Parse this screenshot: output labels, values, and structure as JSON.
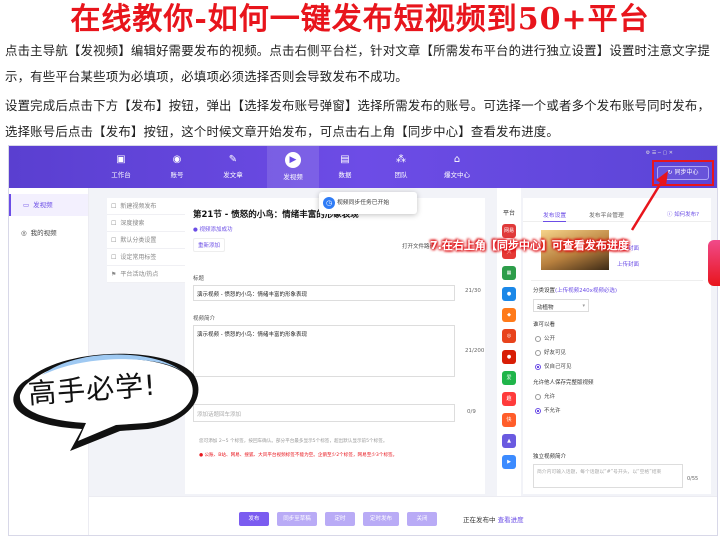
{
  "headline": "在线教你-如何一键发布短视频到50+平台",
  "instructions": {
    "p1": "点击主导航【发视频】编辑好需要发布的视频。点击右侧平台栏，针对文章【所需发布平台的进行独立设置】设置时注意文字提示，有些平台某些项为必填项，必填项必须选择否则会导致发布不成功。",
    "p2": "设置完成后点击下方【发布】按钮，弹出【选择发布账号弹窗】选择所需发布的账号。可选择一个或者多个发布账号同时发布，选择账号后点击【发布】按钮，这个时候文章开始发布，可点击右上角【同步中心】查看发布进度。"
  },
  "app": {
    "nav": [
      {
        "label": "工作台",
        "icon": "monitor-icon"
      },
      {
        "label": "账号",
        "icon": "user-icon"
      },
      {
        "label": "发文章",
        "icon": "edit-icon"
      },
      {
        "label": "发视频",
        "icon": "play-icon"
      },
      {
        "label": "数据",
        "icon": "chart-icon"
      },
      {
        "label": "团队",
        "icon": "team-icon"
      },
      {
        "label": "爆文中心",
        "icon": "home-icon"
      }
    ],
    "window_controls": "⚙ ☰ ─ ▢ ✕",
    "sync_button": "↻ 同步中心",
    "sidebar": [
      "发视频",
      "我的视频"
    ],
    "settings": [
      {
        "icon": "☐",
        "label": "新建视频发布"
      },
      {
        "icon": "☐",
        "label": "深度搜索"
      },
      {
        "icon": "☐",
        "label": "默认分类设置"
      },
      {
        "icon": "☐",
        "label": "设定常用标签"
      },
      {
        "icon": "⚑",
        "label": "平台活动/热点"
      }
    ],
    "toast": "视频同步任务已开始",
    "editor": {
      "article_title": "第21节 - 愤怒的小鸟：情绪丰富的形象表现",
      "video_added": "● 视频添加成功",
      "readd_button": "重新添加",
      "open_folder": "打开文件路径",
      "title_label": "标题",
      "title_value": "演示视频 - 愤怒的小鸟：情绪丰富的形象表现",
      "title_count": "21/30",
      "desc_label": "视频简介",
      "desc_value": "演示视频 - 愤怒的小鸟：情绪丰富的形象表现",
      "desc_count": "21/200",
      "topic_placeholder": "添加话题回车添加",
      "topic_count": "0/9",
      "hint1": "您可添加 2~5 个标签，按回车确认。部分平台最多显示5个标签，超出默认显示前5个标签。",
      "hint2": "● 公账、B站、网易、搜狐、大风平台视频标签不能为空。企鹅至少2个标签，网易至少3个标签。"
    },
    "platform_label": "平台",
    "platforms": [
      {
        "name": "网易",
        "color": "#e03a3a",
        "text": "网易"
      },
      {
        "name": "头条",
        "color": "#e53935",
        "text": "头"
      },
      {
        "name": "腾讯",
        "color": "#2d9d4a",
        "text": "▦"
      },
      {
        "name": "企鹅",
        "color": "#1b88e8",
        "text": "●"
      },
      {
        "name": "大鱼",
        "color": "#ff7a1a",
        "text": "◆"
      },
      {
        "name": "微博",
        "color": "#e8431c",
        "text": "◎"
      },
      {
        "name": "一点",
        "color": "#d81e06",
        "text": "●"
      },
      {
        "name": "爱奇艺",
        "color": "#20b54a",
        "text": "爱"
      },
      {
        "name": "趣头条",
        "color": "#ff3b3b",
        "text": "趣"
      },
      {
        "name": "快手",
        "color": "#ff5d2a",
        "text": "快"
      },
      {
        "name": "视频号",
        "color": "#6a5ae0",
        "text": "▲"
      },
      {
        "name": "好看",
        "color": "#3c8bff",
        "text": "▶"
      }
    ],
    "right_panel": {
      "tab_active": "发布设置",
      "tab2": "发布平台管理",
      "howto": "ⓘ 如何发布?",
      "cover_edit": "更换封面",
      "cover_upload": "上传封面",
      "category_label": "分类设置",
      "category_hint": "(上传视频240x视频必选)",
      "category_value": "动植物",
      "visibility_label": "谁可以看",
      "visibility_options": [
        "公开",
        "好友可见",
        "仅自己可见"
      ],
      "save_label": "允许他人保存完整版视频",
      "save_options": [
        "允许",
        "不允许"
      ],
      "place_label": "独立视频简介",
      "place_placeholder": "简介内可输入话题，每个话题以“#”号开头，以“空格”结束",
      "place_count": "0/55"
    },
    "bottom": {
      "buttons": [
        "发布",
        "同步至草稿",
        "定时",
        "定时发布",
        "关闭"
      ],
      "status_prefix": "正在发布中",
      "status_link": "查看进度"
    }
  },
  "annotation": "7.在右上角【同步中心】可查看发布进度",
  "bubble_text": "高手必学!",
  "colors": {
    "brand": "#6b4de6",
    "annotation": "#e8151c"
  }
}
